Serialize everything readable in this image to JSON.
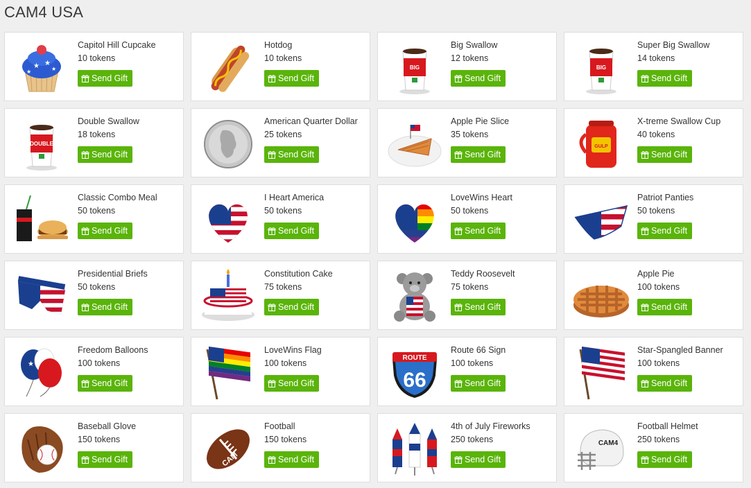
{
  "page": {
    "title": "CAM4 USA"
  },
  "button_label": "Send Gift",
  "gifts": [
    {
      "name": "Capitol Hill Cupcake",
      "price": "10 tokens",
      "icon": "cupcake-icon"
    },
    {
      "name": "Hotdog",
      "price": "10 tokens",
      "icon": "hotdog-icon"
    },
    {
      "name": "Big Swallow",
      "price": "12 tokens",
      "icon": "big-swallow-cup-icon"
    },
    {
      "name": "Super Big Swallow",
      "price": "14 tokens",
      "icon": "super-big-swallow-cup-icon"
    },
    {
      "name": "Double Swallow",
      "price": "18 tokens",
      "icon": "double-swallow-cup-icon"
    },
    {
      "name": "American Quarter Dollar",
      "price": "25 tokens",
      "icon": "quarter-coin-icon"
    },
    {
      "name": "Apple Pie Slice",
      "price": "35 tokens",
      "icon": "pie-slice-icon"
    },
    {
      "name": "X-treme Swallow Cup",
      "price": "40 tokens",
      "icon": "xtreme-cup-icon"
    },
    {
      "name": "Classic Combo Meal",
      "price": "50 tokens",
      "icon": "combo-meal-icon"
    },
    {
      "name": "I Heart America",
      "price": "50 tokens",
      "icon": "flag-heart-icon"
    },
    {
      "name": "LoveWins Heart",
      "price": "50 tokens",
      "icon": "rainbow-heart-icon"
    },
    {
      "name": "Patriot Panties",
      "price": "50 tokens",
      "icon": "panties-icon"
    },
    {
      "name": "Presidential Briefs",
      "price": "50 tokens",
      "icon": "briefs-icon"
    },
    {
      "name": "Constitution Cake",
      "price": "75 tokens",
      "icon": "cake-icon"
    },
    {
      "name": "Teddy Roosevelt",
      "price": "75 tokens",
      "icon": "teddy-bear-icon"
    },
    {
      "name": "Apple Pie",
      "price": "100 tokens",
      "icon": "apple-pie-icon"
    },
    {
      "name": "Freedom Balloons",
      "price": "100 tokens",
      "icon": "balloons-icon"
    },
    {
      "name": "LoveWins Flag",
      "price": "100 tokens",
      "icon": "rainbow-flag-icon"
    },
    {
      "name": "Route 66 Sign",
      "price": "100 tokens",
      "icon": "route-66-sign-icon"
    },
    {
      "name": "Star-Spangled Banner",
      "price": "100 tokens",
      "icon": "us-flag-icon"
    },
    {
      "name": "Baseball Glove",
      "price": "150 tokens",
      "icon": "baseball-glove-icon"
    },
    {
      "name": "Football",
      "price": "150 tokens",
      "icon": "football-icon"
    },
    {
      "name": "4th of July Fireworks",
      "price": "250 tokens",
      "icon": "fireworks-icon"
    },
    {
      "name": "Football Helmet",
      "price": "250 tokens",
      "icon": "football-helmet-icon"
    }
  ],
  "colors": {
    "button": "#5ab40a",
    "background": "#efefef",
    "card": "#ffffff"
  }
}
